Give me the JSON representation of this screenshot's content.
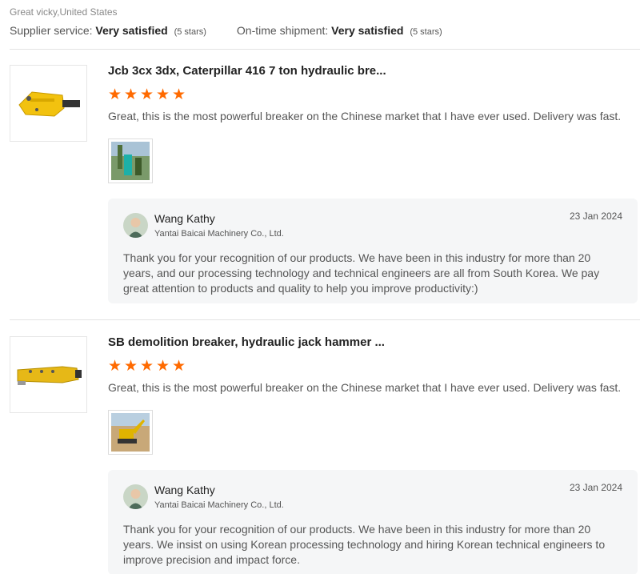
{
  "reviewer": {
    "name_location": "Great vicky,United States"
  },
  "supplier_ratings": [
    {
      "label": "Supplier service:",
      "value": "Very satisfied",
      "stars_note": "(5 stars)"
    },
    {
      "label": "On-time shipment:",
      "value": "Very satisfied",
      "stars_note": "(5 stars)"
    }
  ],
  "reviews": [
    {
      "product_title": "Jcb 3cx 3dx, Caterpillar 416 7 ton hydraulic bre...",
      "rating": 5,
      "text": "Great, this is the most powerful breaker on the Chinese market that I have ever used. Delivery was fast.",
      "reply": {
        "name": "Wang Kathy",
        "company": "Yantai Baicai Machinery Co., Ltd.",
        "date": "23 Jan 2024",
        "text": "Thank you for your recognition of our products. We have been in this industry for more than 20 years, and our processing technology and technical engineers are all from South Korea. We pay great attention to products and quality to help you improve productivity:)"
      }
    },
    {
      "product_title": "SB demolition breaker, hydraulic jack hammer ...",
      "rating": 5,
      "text": "Great, this is the most powerful breaker on the Chinese market that I have ever used. Delivery was fast.",
      "reply": {
        "name": "Wang Kathy",
        "company": "Yantai Baicai Machinery Co., Ltd.",
        "date": "23 Jan 2024",
        "text": "Thank you for your recognition of our products. We have been in this industry for more than 20 years. We insist on using Korean processing technology and hiring Korean technical engineers to improve precision and impact force."
      }
    }
  ],
  "colors": {
    "star": "#ff6a00",
    "reply_bg": "#f5f6f7",
    "product_yellow": "#f2c20f"
  },
  "icons": {
    "star": "star-icon",
    "avatar": "avatar"
  }
}
